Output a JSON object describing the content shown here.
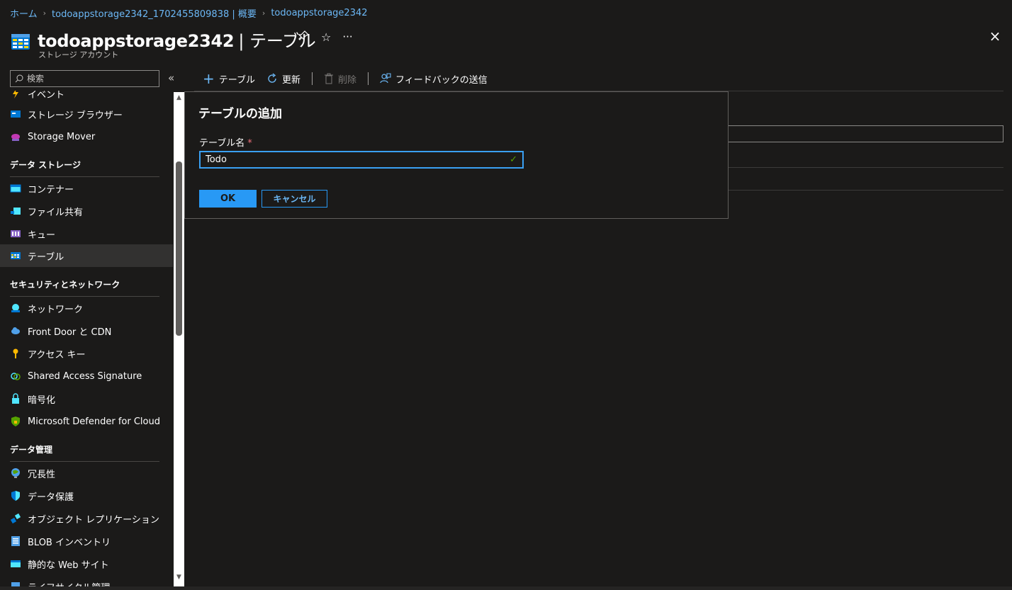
{
  "breadcrumb": {
    "home": "ホーム",
    "overview": "todoappstorage2342_1702455809838 | 概要",
    "current": "todoappstorage2342"
  },
  "header": {
    "title": "todoappstorage2342",
    "section": "テーブル",
    "subtitle": "ストレージ アカウント",
    "more": "···",
    "close": "×"
  },
  "search": {
    "placeholder": "検索"
  },
  "sidebar": {
    "partial_top": "イベント",
    "items_top": [
      {
        "label": "ストレージ ブラウザー",
        "icon": "storage-browser-icon"
      },
      {
        "label": "Storage Mover",
        "icon": "storage-mover-icon"
      }
    ],
    "section_data_storage": "データ ストレージ",
    "data_storage": [
      {
        "label": "コンテナー",
        "icon": "container-icon"
      },
      {
        "label": "ファイル共有",
        "icon": "file-share-icon"
      },
      {
        "label": "キュー",
        "icon": "queue-icon"
      },
      {
        "label": "テーブル",
        "icon": "table-icon"
      }
    ],
    "section_security": "セキュリティとネットワーク",
    "security": [
      {
        "label": "ネットワーク",
        "icon": "network-icon"
      },
      {
        "label": "Front Door と CDN",
        "icon": "cloud-icon"
      },
      {
        "label": "アクセス キー",
        "icon": "key-icon"
      },
      {
        "label": "Shared Access Signature",
        "icon": "link-icon"
      },
      {
        "label": "暗号化",
        "icon": "lock-icon"
      },
      {
        "label": "Microsoft Defender for Cloud",
        "icon": "shield-icon"
      }
    ],
    "section_data_mgmt": "データ管理",
    "data_mgmt": [
      {
        "label": "冗長性",
        "icon": "globe-icon"
      },
      {
        "label": "データ保護",
        "icon": "data-protection-icon"
      },
      {
        "label": "オブジェクト レプリケーション",
        "icon": "replication-icon"
      },
      {
        "label": "BLOB インベントリ",
        "icon": "inventory-icon"
      },
      {
        "label": "静的な Web サイト",
        "icon": "website-icon"
      }
    ],
    "partial_bottom": "ライフサイクル管理"
  },
  "toolbar": {
    "add_table": "テーブル",
    "refresh": "更新",
    "delete": "削除",
    "feedback": "フィードバックの送信"
  },
  "dialog": {
    "title": "テーブルの追加",
    "field_label": "テーブル名",
    "required_mark": "*",
    "value": "Todo",
    "ok": "OK",
    "cancel": "キャンセル"
  },
  "colors": {
    "accent": "#2899f5",
    "link": "#6cb8f6",
    "background": "#1b1a19",
    "valid": "#57a300"
  }
}
